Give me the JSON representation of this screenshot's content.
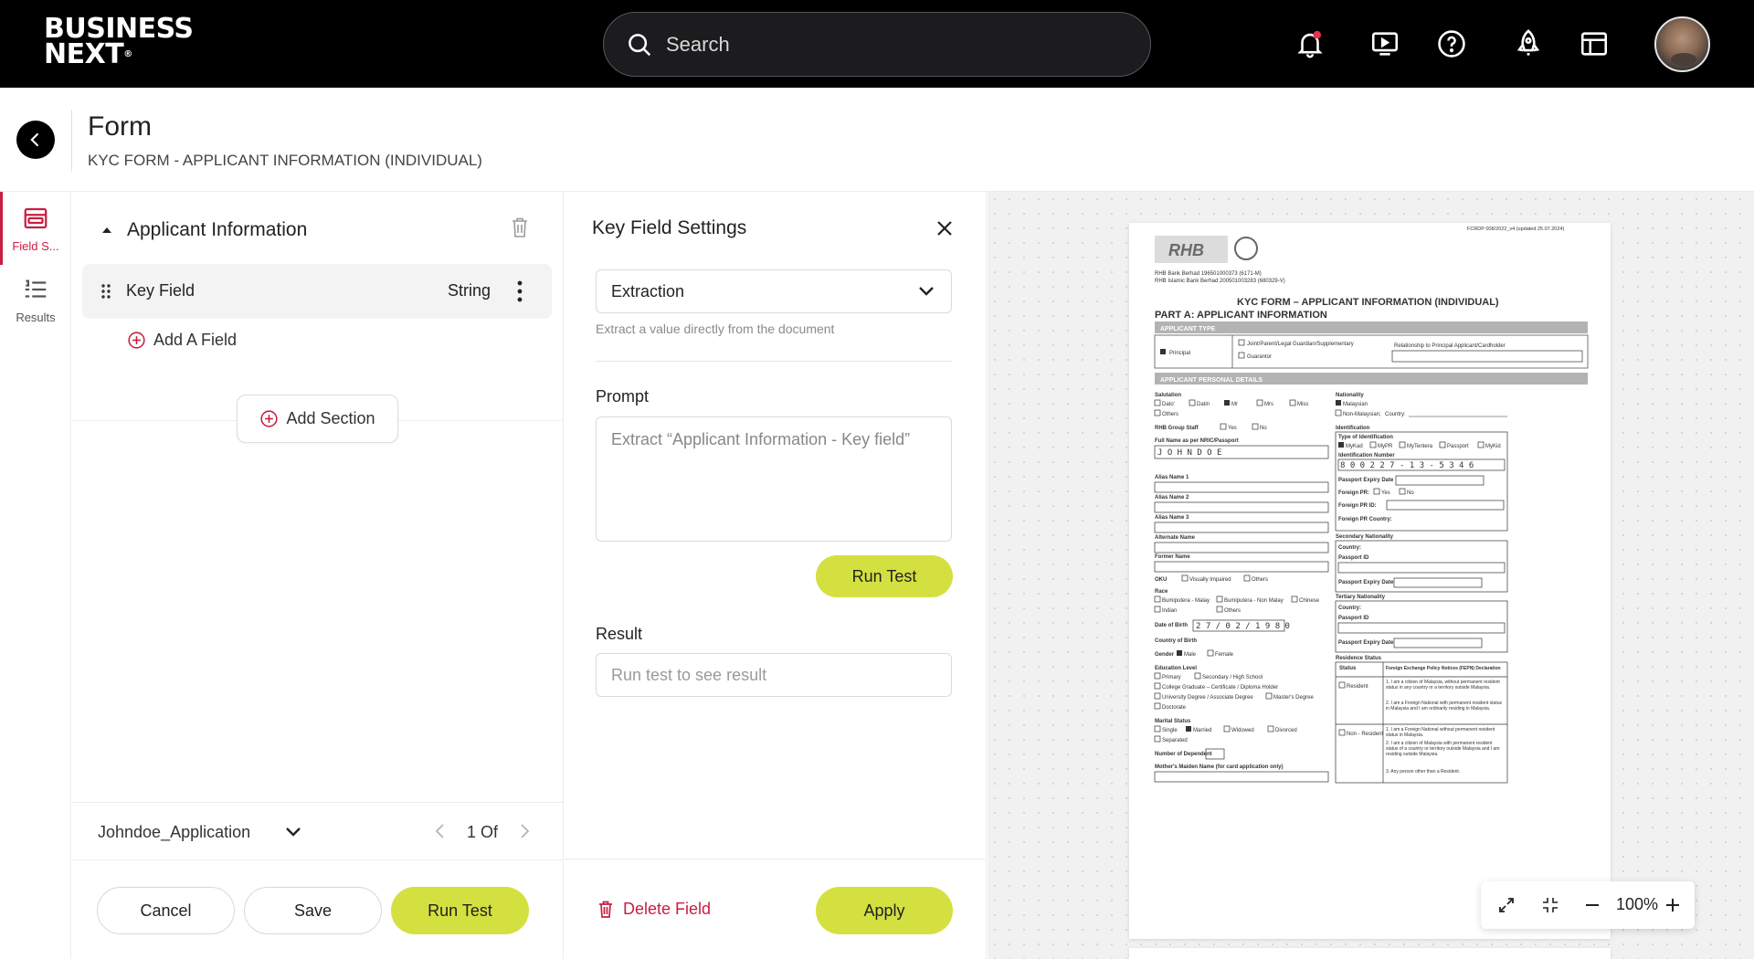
{
  "topbar": {
    "logo_line1": "BUSINESS",
    "logo_line2": "NEXT",
    "search_placeholder": "Search",
    "icons": [
      "bell-notification-icon",
      "presentation-play-icon",
      "help-circle-icon",
      "rocket-icon",
      "layout-panel-icon"
    ],
    "notification_dot_color": "#e8334a"
  },
  "header": {
    "title": "Form",
    "subtitle": "KYC FORM - APPLICANT INFORMATION (INDIVIDUAL)"
  },
  "rail": {
    "items": [
      {
        "label": "Field S...",
        "icon": "field-structure-icon",
        "active": true
      },
      {
        "label": "Results",
        "icon": "results-list-icon",
        "active": false
      }
    ]
  },
  "structure": {
    "section_title": "Applicant Information",
    "field": {
      "name": "Key Field",
      "type": "String"
    },
    "add_field_label": "Add A Field",
    "add_section_label": "Add Section",
    "document_name": "Johndoe_Application",
    "pager_text": "1 Of",
    "buttons": {
      "cancel": "Cancel",
      "save": "Save",
      "run_test": "Run Test"
    }
  },
  "settings": {
    "title": "Key Field Settings",
    "method_value": "Extraction",
    "method_help": "Extract a value directly from the document",
    "prompt_label": "Prompt",
    "prompt_value": "Extract “Applicant Information - Key field”",
    "run_test_label": "Run Test",
    "result_label": "Result",
    "result_placeholder": "Run test to see result",
    "delete_label": "Delete Field",
    "apply_label": "Apply"
  },
  "viewer": {
    "zoom": "100%",
    "doc": {
      "ref": "FCRDP 008/2022_v4 (updated 25.07.2024)",
      "bank_logo": "RHB",
      "bank_line1": "RHB Bank Berhad 196501000373 (6171-M)",
      "bank_line2": "RHB Islamic Bank Berhad 200501003283 (680329-V)",
      "title": "KYC FORM – APPLICANT INFORMATION (INDIVIDUAL)",
      "part": "PART A: APPLICANT INFORMATION",
      "bar_applicant_type": "APPLICANT TYPE",
      "bar_personal": "APPLICANT PERSONAL DETAILS",
      "type_principal": "Principal",
      "type_joint": "Joint/Parent/Legal Guardian/Supplementary",
      "type_guarantor": "Guarantor",
      "type_relationship": "Relationship to Principal Applicant/Cardholder",
      "salutation": "Salutation",
      "sal_options": [
        "Dato'",
        "Datin",
        "Mr",
        "Mrs",
        "Miss"
      ],
      "others": "Others",
      "group_staff": "RHB Group Staff",
      "yes": "Yes",
      "no": "No",
      "full_name_label": "Full Name as per NRIC/Passport",
      "full_name_value": "J O H N   D O E",
      "alias1": "Alias Name 1",
      "alias2": "Alias Name 2",
      "alias3": "Alias Name 3",
      "alt_name": "Alternate Name",
      "former_name": "Former Name",
      "oku": "OKU",
      "visually_impaired": "Visually Impaired",
      "race": "Race",
      "race_options": [
        "Bumiputera - Malay",
        "Bumiputera - Non Malay",
        "Chinese",
        "Indian",
        "Others"
      ],
      "dob_label": "Date of Birth",
      "dob_value": "2 7 / 0 2 / 1 9 8 0",
      "country_birth": "Country of Birth",
      "gender": "Gender",
      "male": "Male",
      "female": "Female",
      "education": "Education Level",
      "edu_options": [
        "Primary",
        "Secondary / High School",
        "College Graduate – Certificate / Diploma Holder",
        "University Degree / Associate Degree",
        "Master's Degree",
        "Doctorate"
      ],
      "marital": "Marital Status",
      "marital_options": [
        "Single",
        "Married",
        "Widowed",
        "Divorced",
        "Separated"
      ],
      "dependents": "Number of Dependent",
      "maiden": "Mother's Maiden Name (for card application only)",
      "nationality": "Nationality",
      "malaysian": "Malaysian",
      "non_malaysian": "Non-Malaysian;",
      "country": "Country:",
      "identification": "Identification",
      "type_id": "Type of Identification",
      "id_options": [
        "MyKad",
        "MyPR",
        "MyTentera",
        "Passport",
        "MyKid"
      ],
      "id_number_label": "Identification Number",
      "id_number_value": "8 0 0 2 2 7 - 1 3 - 5 3 4 6",
      "passport_expiry": "Passport Expiry Date",
      "foreign_pr": "Foreign PR:",
      "foreign_pr_id": "Foreign PR ID:",
      "foreign_pr_country": "Foreign PR Country:",
      "secondary_nat": "Secondary Nationality",
      "tertiary_nat": "Tertiary Nationality",
      "passport_id": "Passport ID",
      "residence": "Residence Status",
      "status": "Status",
      "fepn": "Foreign Exchange Policy Notices (FEPN) Declaration",
      "resident": "Resident",
      "non_resident": "Non - Resident",
      "fepn_res_1": "1. I am a citizen of Malaysia, without permanent resident status in any country or a territory outside Malaysia.",
      "fepn_res_2": "2. I am a Foreign National with permanent resident status in Malaysia and I am ordinarily residing in Malaysia.",
      "fepn_non_1": "1. I am a Foreign National without permanent resident status in Malaysia.",
      "fepn_non_2": "2. I am a citizen of Malaysia with permanent resident status of a country or territory outside Malaysia and I am residing outside Malaysia.",
      "fepn_non_3": "3. Any person other than a Resident."
    }
  }
}
